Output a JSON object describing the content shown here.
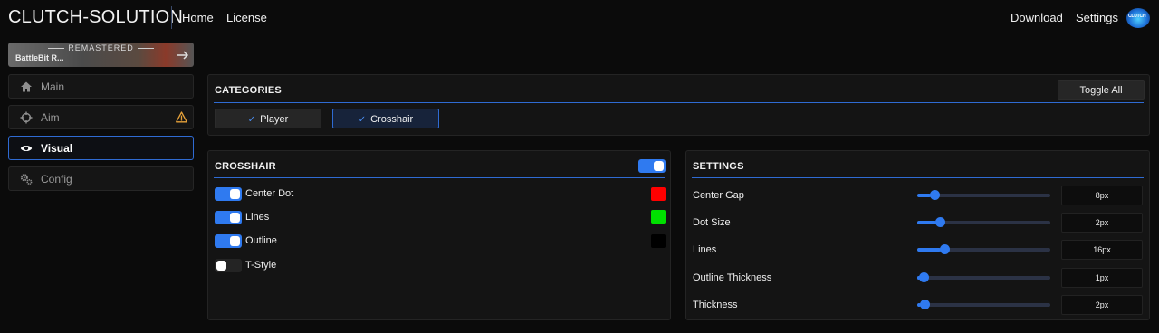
{
  "header": {
    "brand": "CLUTCH-SOLUTION",
    "nav": {
      "home": "Home",
      "license": "License",
      "download": "Download",
      "settings": "Settings"
    }
  },
  "sidebar": {
    "game": {
      "banner": "REMASTERED",
      "name": "BattleBit R..."
    },
    "items": [
      {
        "label": "Main",
        "icon": "home-icon"
      },
      {
        "label": "Aim",
        "icon": "crosshair-icon",
        "warning": true
      },
      {
        "label": "Visual",
        "icon": "eye-icon",
        "active": true
      },
      {
        "label": "Config",
        "icon": "gears-icon"
      }
    ]
  },
  "categories": {
    "title": "CATEGORIES",
    "toggle_all": "Toggle All",
    "tabs": [
      {
        "label": "Player",
        "active": false
      },
      {
        "label": "Crosshair",
        "active": true
      }
    ]
  },
  "crosshair": {
    "title": "CROSSHAIR",
    "enabled": true,
    "options": [
      {
        "label": "Center Dot",
        "on": true,
        "color": "#ff0000"
      },
      {
        "label": "Lines",
        "on": true,
        "color": "#00ff00"
      },
      {
        "label": "Outline",
        "on": true,
        "color": "#000000"
      },
      {
        "label": "T-Style",
        "on": false
      }
    ]
  },
  "settings": {
    "title": "SETTINGS",
    "items": [
      {
        "label": "Center Gap",
        "value": "8px",
        "level": 0.1
      },
      {
        "label": "Dot Size",
        "value": "2px",
        "level": 0.14
      },
      {
        "label": "Lines",
        "value": "16px",
        "level": 0.18
      },
      {
        "label": "Outline Thickness",
        "value": "1px",
        "level": 0.02
      },
      {
        "label": "Thickness",
        "value": "2px",
        "level": 0.03
      }
    ]
  },
  "colors": {
    "accent": "#2f7af0",
    "warning": "#e8a33a"
  }
}
